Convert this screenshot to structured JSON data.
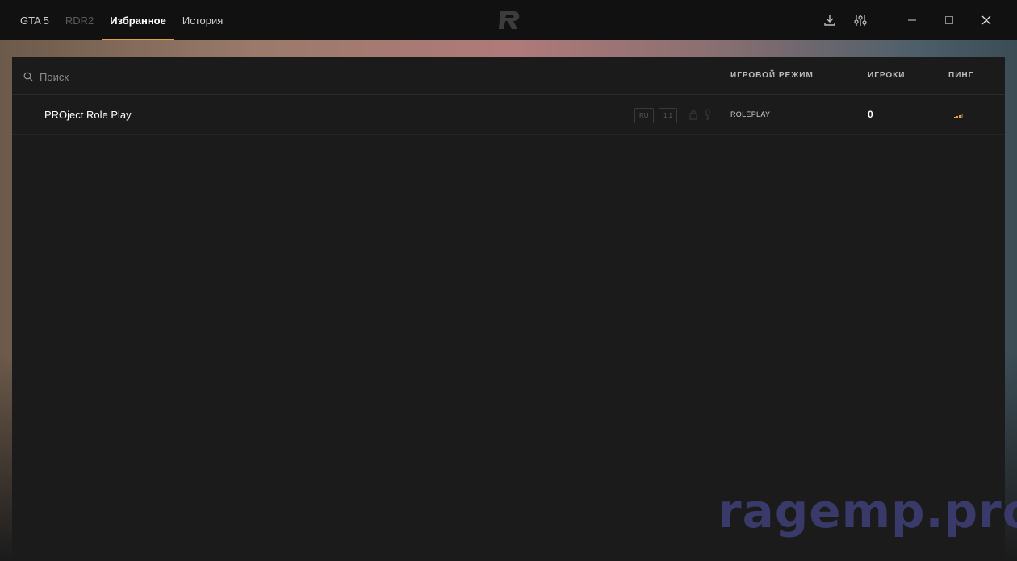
{
  "tabs": [
    {
      "label": "GTA 5",
      "state": "normal"
    },
    {
      "label": "RDR2",
      "state": "disabled"
    },
    {
      "label": "Избранное",
      "state": "active"
    },
    {
      "label": "История",
      "state": "normal"
    }
  ],
  "logo_icon": "rage-r-logo-icon",
  "toolbar": {
    "download_icon": "download-icon",
    "settings_icon": "sliders-icon"
  },
  "window_controls": [
    "minimize-icon",
    "maximize-icon",
    "close-icon"
  ],
  "search": {
    "placeholder": "Поиск",
    "value": ""
  },
  "columns": {
    "mode": "ИГРОВОЙ РЕЖИМ",
    "players": "ИГРОКИ",
    "ping": "ПИНГ"
  },
  "servers": [
    {
      "name": "PROject Role Play",
      "lang": "RU",
      "version": "1.1",
      "mode": "ROLEPLAY",
      "players": "0",
      "ping_level": 3,
      "ping_color": "#e8a13a"
    }
  ],
  "watermark": "ragemp.pro",
  "colors": {
    "accent": "#e8a13a",
    "bar_bg": "#111111",
    "panel_bg": "#1b1b1b"
  }
}
